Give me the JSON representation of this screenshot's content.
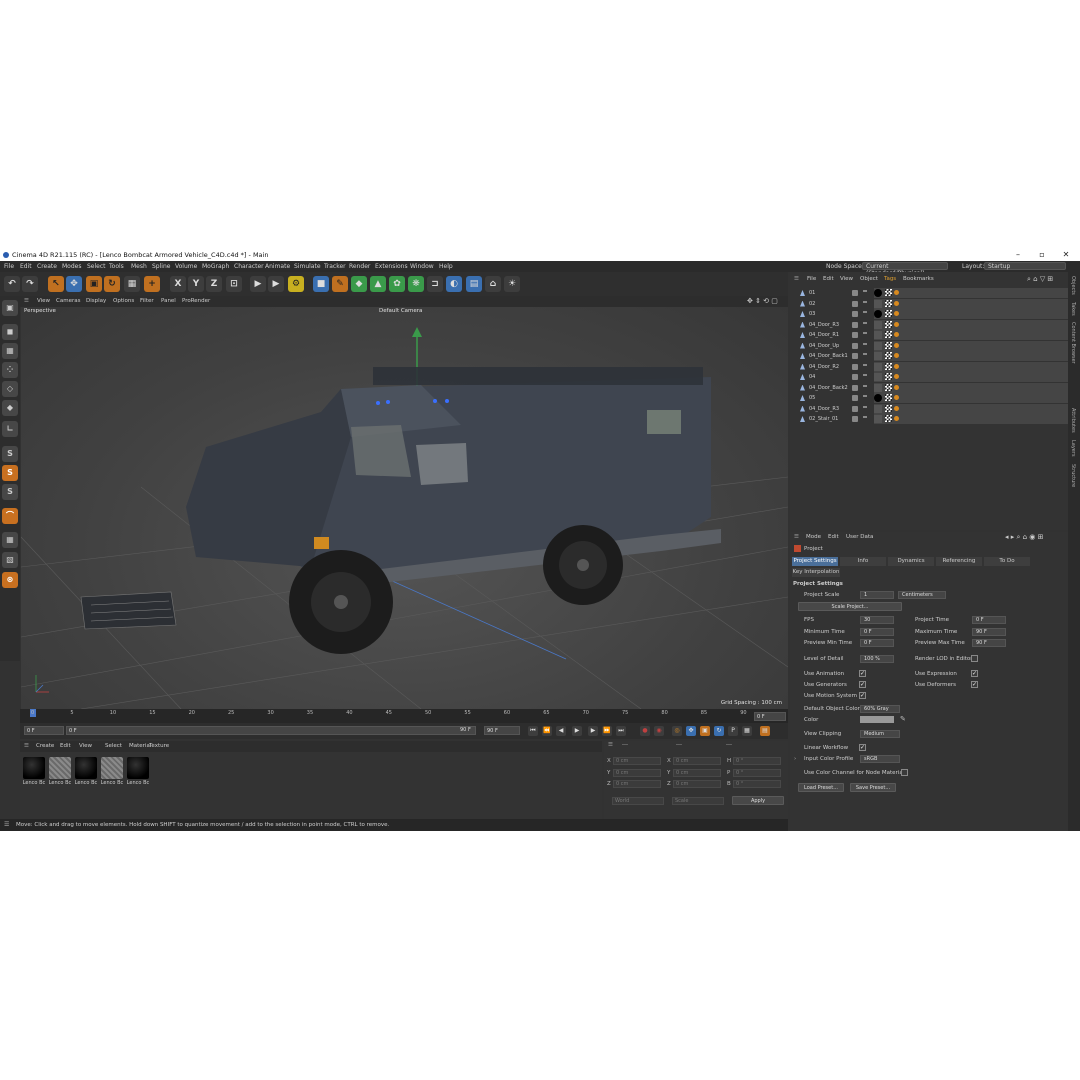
{
  "window": {
    "title": "Cinema 4D R21.115 (RC) - [Lenco Bombcat Armored Vehicle_C4D.c4d *] - Main"
  },
  "menubar": {
    "items": [
      "File",
      "Edit",
      "Create",
      "Modes",
      "Select",
      "Tools",
      "Mesh",
      "Spline",
      "Volume",
      "MoGraph",
      "Character",
      "Animate",
      "Simulate",
      "Tracker",
      "Render",
      "Extensions",
      "Window",
      "Help"
    ],
    "node_space_label": "Node Space:",
    "node_space_value": "Current (Standard/Physical)",
    "layout_label": "Layout:",
    "layout_value": "Startup"
  },
  "viewport": {
    "menu": [
      "View",
      "Cameras",
      "Display",
      "Options",
      "Filter",
      "Panel",
      "ProRender"
    ],
    "view_name": "Perspective",
    "camera": "Default Camera",
    "grid_spacing": "Grid Spacing : 100 cm"
  },
  "timeline": {
    "ticks": [
      "0",
      "5",
      "10",
      "15",
      "20",
      "25",
      "30",
      "35",
      "40",
      "45",
      "50",
      "55",
      "60",
      "65",
      "70",
      "75",
      "80",
      "85",
      "90"
    ],
    "current_frame": "0 F",
    "start": "0 F",
    "range_start": "0 F",
    "range_end": "90 F",
    "end": "90 F"
  },
  "materials": {
    "menu": [
      "Create",
      "Edit",
      "View",
      "Select",
      "Material",
      "Texture"
    ],
    "items": [
      {
        "label": "Lenco Bc",
        "color": "#000000"
      },
      {
        "label": "Lenco Bc",
        "color": "#7a7a7a"
      },
      {
        "label": "Lenco Bc",
        "color": "#000000"
      },
      {
        "label": "Lenco Bc",
        "color": "#7a7a7a"
      },
      {
        "label": "Lenco Bc",
        "color": "#000000"
      }
    ]
  },
  "coordinates": {
    "header": "---",
    "rows": [
      {
        "a": "X",
        "av": "0 cm",
        "b": "X",
        "bv": "0 cm",
        "c": "H",
        "cv": "0 °"
      },
      {
        "a": "Y",
        "av": "0 cm",
        "b": "Y",
        "bv": "0 cm",
        "c": "P",
        "cv": "0 °"
      },
      {
        "a": "Z",
        "av": "0 cm",
        "b": "Z",
        "bv": "0 cm",
        "c": "B",
        "cv": "0 °"
      }
    ],
    "mode1": "World",
    "mode2": "Scale",
    "apply": "Apply"
  },
  "status": "Move: Click and drag to move elements. Hold down SHIFT to quantize movement / add to the selection in point mode, CTRL to remove.",
  "objects": {
    "menu": [
      "File",
      "Edit",
      "View",
      "Object",
      "Tags",
      "Bookmarks"
    ],
    "rows": [
      {
        "name": "01",
        "tag": "black"
      },
      {
        "name": "02",
        "tag": "grey"
      },
      {
        "name": "03",
        "tag": "black"
      },
      {
        "name": "04_Door_R3",
        "tag": "grey"
      },
      {
        "name": "04_Door_R1",
        "tag": "grey"
      },
      {
        "name": "04_Door_Up",
        "tag": "grey"
      },
      {
        "name": "04_Door_Back1",
        "tag": "grey"
      },
      {
        "name": "04_Door_R2",
        "tag": "grey"
      },
      {
        "name": "04",
        "tag": "grey"
      },
      {
        "name": "04_Door_Back2",
        "tag": "grey"
      },
      {
        "name": "05",
        "tag": "black"
      },
      {
        "name": "04_Door_R3",
        "tag": "grey"
      },
      {
        "name": "02_Stair_01",
        "tag": "grey"
      }
    ]
  },
  "attributes": {
    "menu": [
      "Mode",
      "Edit",
      "User Data"
    ],
    "title": "Project",
    "tabs": [
      "Project Settings",
      "Info",
      "Dynamics",
      "Referencing",
      "To Do"
    ],
    "subtab": "Key Interpolation",
    "section": "Project Settings",
    "project_scale_label": "Project Scale",
    "project_scale_value": "1",
    "project_scale_unit": "Centimeters",
    "scale_project_btn": "Scale Project...",
    "fps_label": "FPS",
    "fps": "30",
    "project_time_label": "Project Time",
    "project_time": "0 F",
    "min_time_label": "Minimum Time",
    "min_time": "0 F",
    "max_time_label": "Maximum Time",
    "max_time": "90 F",
    "prev_min_label": "Preview Min Time",
    "prev_min": "0 F",
    "prev_max_label": "Preview Max Time",
    "prev_max": "90 F",
    "lod_label": "Level of Detail",
    "lod": "100 %",
    "render_lod_label": "Render LOD in Editor",
    "use_animation": "Use Animation",
    "use_expression": "Use Expression",
    "use_generators": "Use Generators",
    "use_deformers": "Use Deformers",
    "use_motion": "Use Motion System",
    "default_color_label": "Default Object Color",
    "default_color_value": "60% Gray",
    "color_label": "Color",
    "view_clipping_label": "View Clipping",
    "view_clipping_value": "Medium",
    "linear_workflow": "Linear Workflow",
    "input_profile_label": "Input Color Profile",
    "input_profile_value": "sRGB",
    "color_channel": "Use Color Channel for Node Material",
    "load_preset": "Load Preset...",
    "save_preset": "Save Preset..."
  },
  "sidetabs": [
    "Objects",
    "Takes",
    "Content Browser",
    "Attributes",
    "Layers",
    "Structure"
  ]
}
